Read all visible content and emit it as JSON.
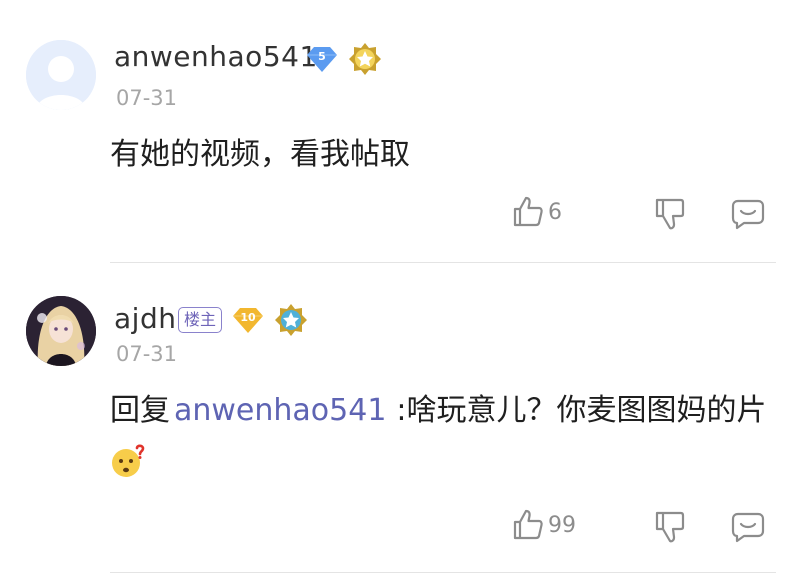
{
  "comments": [
    {
      "username": "anwenhao541",
      "vip_level": "5",
      "date": "07-31",
      "text": "有她的视频，看我帖取",
      "likes": "6",
      "icons": {
        "avatar": "default-avatar-icon",
        "vip": "diamond-vip-icon",
        "medal": "star-medal-icon"
      },
      "colors": {
        "vip": "#5b9bf0"
      }
    },
    {
      "username": "ajdh",
      "op_tag": "楼主",
      "level": "10",
      "date": "07-31",
      "reply_prefix": "回复",
      "reply_to": "anwenhao541",
      "text": ":啥玩意儿？你麦图图妈的片",
      "likes": "99",
      "icons": {
        "avatar": "anime-girl-avatar",
        "level": "diamond-level-icon",
        "medal": "blue-star-medal-icon",
        "emoji": "confused-face-emoji"
      },
      "colors": {
        "level": "#f2b72f",
        "mention": "#5e64b3"
      }
    }
  ]
}
